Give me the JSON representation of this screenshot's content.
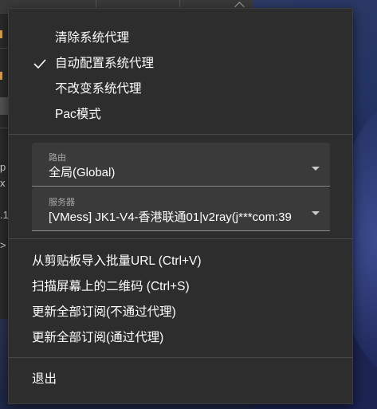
{
  "background": {
    "left_glyphs": [
      "p",
      "x",
      ".1",
      ">"
    ]
  },
  "menu": {
    "proxy_modes": [
      {
        "label": "清除系统代理",
        "checked": false
      },
      {
        "label": "自动配置系统代理",
        "checked": true
      },
      {
        "label": "不改变系统代理",
        "checked": false
      },
      {
        "label": "Pac模式",
        "checked": false
      }
    ],
    "routing": {
      "label": "路由",
      "value": "全局(Global)"
    },
    "server": {
      "label": "服务器",
      "value": "[VMess] JK1-V4-香港联通01|v2ray(j***com:39"
    },
    "actions": [
      "从剪贴板导入批量URL (Ctrl+V)",
      "扫描屏幕上的二维码 (Ctrl+S)",
      "更新全部订阅(不通过代理)",
      "更新全部订阅(通过代理)"
    ],
    "exit_label": "退出"
  },
  "colors": {
    "menu_bg": "#2d2d2d",
    "field_bg": "#3a3a3a",
    "text": "#ffffff",
    "field_label": "#a7a7a7",
    "accent_orange": "#e8a33c"
  }
}
